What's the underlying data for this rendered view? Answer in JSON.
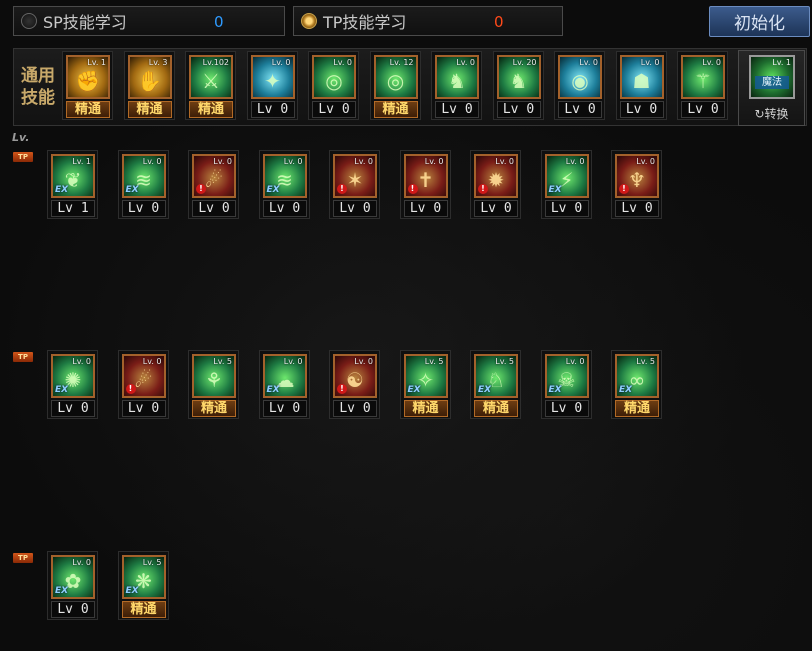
{
  "header": {
    "sp_tab": {
      "label": "SP技能学习",
      "points": "0",
      "points_color": "#2f9bff"
    },
    "tp_tab": {
      "label": "TP技能学习",
      "points": "0",
      "points_color": "#ff4a1a"
    },
    "init_button": "初始化"
  },
  "common": {
    "label_line1": "通用",
    "label_line2": "技能",
    "skills": [
      {
        "lv_tag": "Lv. 1",
        "level": "精通",
        "master": true,
        "style": "gold",
        "glyph": "✊"
      },
      {
        "lv_tag": "Lv. 3",
        "level": "精通",
        "master": true,
        "style": "gold",
        "glyph": "✋"
      },
      {
        "lv_tag": "Lv.102",
        "level": "精通",
        "master": true,
        "style": "teal",
        "glyph": "⚔"
      },
      {
        "lv_tag": "Lv. 0",
        "level": "Lv 0",
        "master": false,
        "style": "blue",
        "glyph": "✦"
      },
      {
        "lv_tag": "Lv. 0",
        "level": "Lv 0",
        "master": false,
        "style": "teal",
        "glyph": "◎"
      },
      {
        "lv_tag": "Lv. 12",
        "level": "精通",
        "master": true,
        "style": "teal",
        "glyph": "◎"
      },
      {
        "lv_tag": "Lv. 0",
        "level": "Lv 0",
        "master": false,
        "style": "teal",
        "glyph": "♞"
      },
      {
        "lv_tag": "Lv. 20",
        "level": "Lv 0",
        "master": false,
        "style": "teal",
        "glyph": "♞"
      },
      {
        "lv_tag": "Lv. 0",
        "level": "Lv 0",
        "master": false,
        "style": "blue",
        "glyph": "◉"
      },
      {
        "lv_tag": "Lv. 0",
        "level": "Lv 0",
        "master": false,
        "style": "blue",
        "glyph": "☗"
      },
      {
        "lv_tag": "Lv. 0",
        "level": "Lv 0",
        "master": false,
        "style": "teal",
        "glyph": "⚚"
      }
    ],
    "convert": {
      "tag": "魔法",
      "label": "↻转换",
      "lv_tag": "Lv. 1"
    }
  },
  "lv_label": "Lv.",
  "tp_badge": "TP",
  "rows": [
    {
      "skills": [
        {
          "lv_tag": "Lv. 1",
          "level": "Lv 1",
          "master": false,
          "style": "teal",
          "mark": "ex",
          "glyph": "❦"
        },
        {
          "lv_tag": "Lv. 0",
          "level": "Lv 0",
          "master": false,
          "style": "teal",
          "mark": "ex",
          "glyph": "≋"
        },
        {
          "lv_tag": "Lv. 0",
          "level": "Lv 0",
          "master": false,
          "style": "red",
          "mark": "warn",
          "glyph": "☄"
        },
        {
          "lv_tag": "Lv. 0",
          "level": "Lv 0",
          "master": false,
          "style": "teal",
          "mark": "ex",
          "glyph": "≋"
        },
        {
          "lv_tag": "Lv. 0",
          "level": "Lv 0",
          "master": false,
          "style": "red",
          "mark": "warn",
          "glyph": "✶"
        },
        {
          "lv_tag": "Lv. 0",
          "level": "Lv 0",
          "master": false,
          "style": "red",
          "mark": "warn",
          "glyph": "✝"
        },
        {
          "lv_tag": "Lv. 0",
          "level": "Lv 0",
          "master": false,
          "style": "red",
          "mark": "warn",
          "glyph": "✹"
        },
        {
          "lv_tag": "Lv. 0",
          "level": "Lv 0",
          "master": false,
          "style": "teal",
          "mark": "ex",
          "glyph": "⚡"
        },
        {
          "lv_tag": "Lv. 0",
          "level": "Lv 0",
          "master": false,
          "style": "red",
          "mark": "warn",
          "glyph": "♆"
        }
      ]
    },
    {
      "skills": [
        {
          "lv_tag": "Lv. 0",
          "level": "Lv 0",
          "master": false,
          "style": "teal",
          "mark": "ex",
          "glyph": "✺"
        },
        {
          "lv_tag": "Lv. 0",
          "level": "Lv 0",
          "master": false,
          "style": "red",
          "mark": "warn",
          "glyph": "☄"
        },
        {
          "lv_tag": "Lv. 5",
          "level": "精通",
          "master": true,
          "style": "teal",
          "mark": "",
          "glyph": "⚘"
        },
        {
          "lv_tag": "Lv. 0",
          "level": "Lv 0",
          "master": false,
          "style": "teal",
          "mark": "ex",
          "glyph": "☁"
        },
        {
          "lv_tag": "Lv. 0",
          "level": "Lv 0",
          "master": false,
          "style": "red",
          "mark": "warn",
          "glyph": "☯"
        },
        {
          "lv_tag": "Lv. 5",
          "level": "精通",
          "master": true,
          "style": "teal",
          "mark": "ex",
          "glyph": "✧"
        },
        {
          "lv_tag": "Lv. 5",
          "level": "精通",
          "master": true,
          "style": "teal",
          "mark": "ex",
          "glyph": "♘"
        },
        {
          "lv_tag": "Lv. 0",
          "level": "Lv 0",
          "master": false,
          "style": "teal",
          "mark": "ex",
          "glyph": "☠"
        },
        {
          "lv_tag": "Lv. 5",
          "level": "精通",
          "master": true,
          "style": "teal",
          "mark": "ex",
          "glyph": "∞"
        }
      ]
    },
    {
      "skills": [
        {
          "lv_tag": "Lv. 0",
          "level": "Lv 0",
          "master": false,
          "style": "teal",
          "mark": "ex",
          "glyph": "✿"
        },
        {
          "lv_tag": "Lv. 5",
          "level": "精通",
          "master": true,
          "style": "teal",
          "mark": "ex",
          "glyph": "❋"
        }
      ]
    }
  ]
}
